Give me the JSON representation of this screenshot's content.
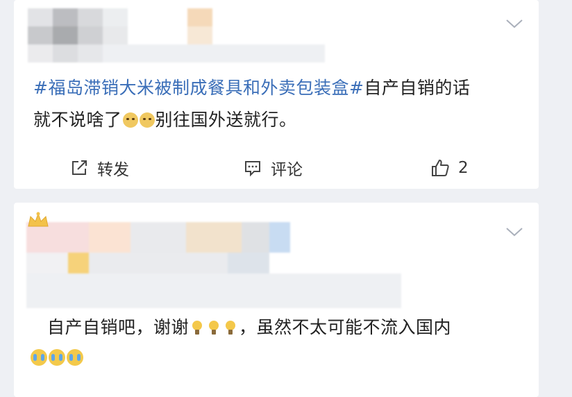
{
  "post": {
    "topic": "#福岛滞销大米被制成餐具和外卖包装盒#",
    "text_after_topic": "自产自销的话",
    "line2_before_emoji": "就不说啥了",
    "line2_after_emoji": "别往国外送就行。",
    "emoji_icon": "cat-face-icon",
    "actions": {
      "repost_label": "转发",
      "comment_label": "评论",
      "like_count": "2"
    }
  },
  "comment": {
    "text_before_emoji": "自产自销吧，谢谢",
    "text_after_emoji": "，虽然不太可能不流入国内",
    "emoji_icons": [
      "lightbulb-icon",
      "crying-face-icon"
    ],
    "badge_icon": "crown-icon"
  },
  "colors": {
    "topic": "#3a6eb8",
    "background": "#eef0f4",
    "card": "#ffffff"
  }
}
